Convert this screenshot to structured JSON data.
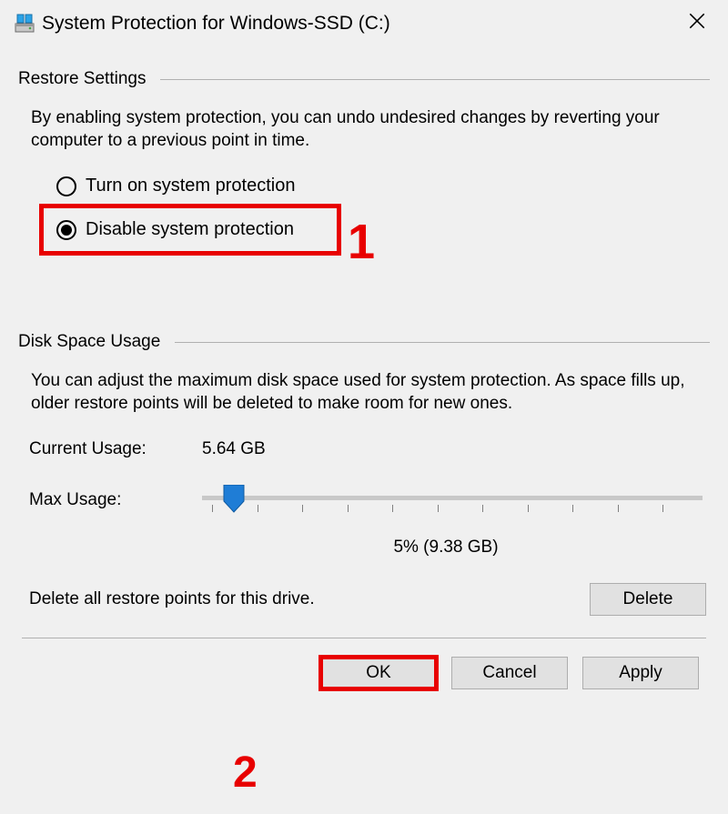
{
  "window": {
    "title": "System Protection for Windows-SSD (C:)"
  },
  "restore": {
    "section_label": "Restore Settings",
    "description": "By enabling system protection, you can undo undesired changes by reverting your computer to a previous point in time.",
    "radio_on_label": "Turn on system protection",
    "radio_off_label": "Disable system protection"
  },
  "disk": {
    "section_label": "Disk Space Usage",
    "description": "You can adjust the maximum disk space used for system protection. As space fills up, older restore points will be deleted to make room for new ones.",
    "current_usage_label": "Current Usage:",
    "current_usage_value": "5.64 GB",
    "max_usage_label": "Max Usage:",
    "slider_caption": "5% (9.38 GB)",
    "delete_desc": "Delete all restore points for this drive.",
    "delete_btn": "Delete"
  },
  "footer": {
    "ok": "OK",
    "cancel": "Cancel",
    "apply": "Apply"
  },
  "annotations": {
    "one": "1",
    "two": "2"
  }
}
